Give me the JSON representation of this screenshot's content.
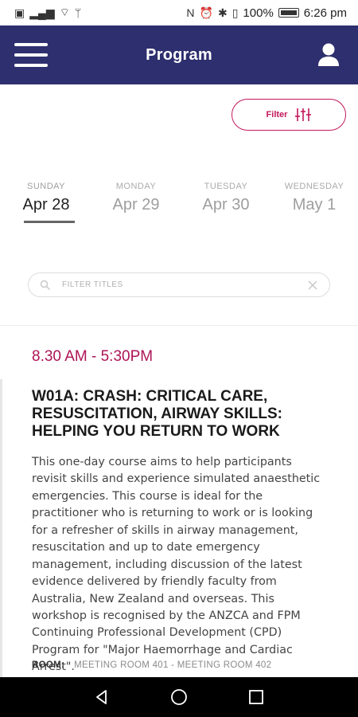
{
  "status_bar": {
    "left_glyphs": [
      "▣",
      "▂▄▆",
      "⌔",
      "ᛘ"
    ],
    "right_glyphs": [
      "N",
      "⏰",
      "✱",
      "▯"
    ],
    "battery_percent": "100%",
    "time": "6:26 pm"
  },
  "app_bar": {
    "title": "Program",
    "menu_icon": "hamburger-icon",
    "profile_icon": "person-icon",
    "color": "#2e2f6e"
  },
  "filter": {
    "label": "Filter",
    "icon": "sliders-icon",
    "color": "#c2185b"
  },
  "date_tabs": [
    {
      "dow": "SUNDAY",
      "day": "Apr 28",
      "active": true
    },
    {
      "dow": "MONDAY",
      "day": "Apr 29",
      "active": false
    },
    {
      "dow": "TUESDAY",
      "day": "Apr 30",
      "active": false
    },
    {
      "dow": "WEDNESDAY",
      "day": "May 1",
      "active": false
    }
  ],
  "search": {
    "placeholder": "FILTER TITLES",
    "value": ""
  },
  "session": {
    "time": "8.30 AM - 5:30PM",
    "title": "W01A: CRASH: CRITICAL CARE, RESUSCITATION, AIRWAY SKILLS: HELPING YOU RETURN TO WORK",
    "description": "This one-day course aims to help participants revisit skills and experience simulated anaesthetic emergencies. This course is ideal for the practitioner who is returning to work or is looking for a refresher of skills in airway management, resuscitation and up to date emergency management, including discussion of the latest evidence delivered by friendly faculty from Australia, New Zealand and overseas. This workshop is recognised by the ANZCA and FPM Continuing Professional Development (CPD) Program for \"Major Haemorrhage and Cardiac Arrest\".",
    "room_label": "ROOM:",
    "room": "MEETING ROOM 401 - MEETING ROOM 402",
    "time_color": "#ad1457"
  },
  "nav_bar": {
    "icons": [
      "back-icon",
      "home-icon",
      "recents-icon"
    ]
  }
}
